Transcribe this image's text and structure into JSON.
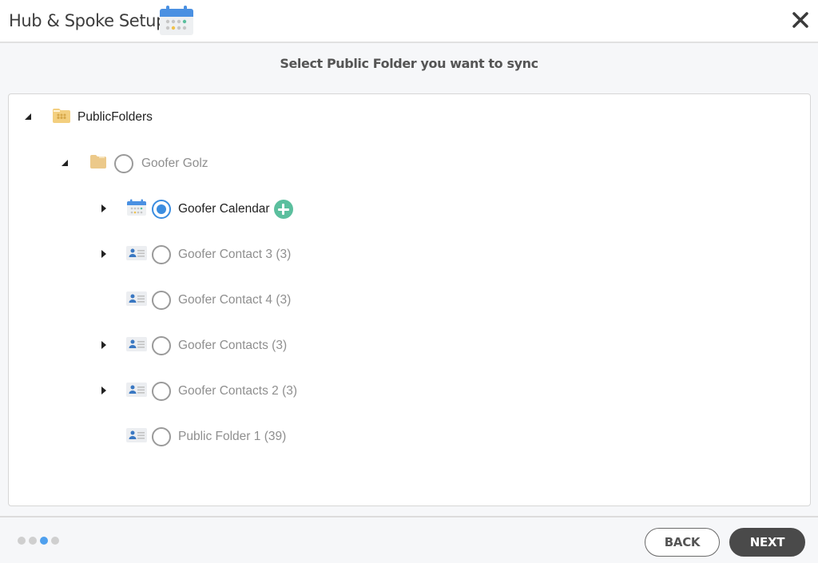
{
  "header": {
    "title": "Hub & Spoke Setup",
    "icon": "calendar-icon",
    "close_icon": "close-icon"
  },
  "subtitle": "Select Public Folder you want to sync",
  "tree": {
    "root": {
      "label": "PublicFolders",
      "icon": "public-folder-icon",
      "expanded": true
    },
    "group": {
      "label": "Goofer Golz",
      "icon": "folder-icon",
      "expanded": true,
      "selected": false
    },
    "items": [
      {
        "label": "Goofer Calendar",
        "icon": "calendar-icon",
        "expandable": true,
        "selected": true,
        "has_add": true
      },
      {
        "label": "Goofer Contact 3 (3)",
        "icon": "contact-card-icon",
        "expandable": true,
        "selected": false
      },
      {
        "label": "Goofer Contact 4 (3)",
        "icon": "contact-card-icon",
        "expandable": false,
        "selected": false
      },
      {
        "label": "Goofer Contacts (3)",
        "icon": "contact-card-icon",
        "expandable": true,
        "selected": false
      },
      {
        "label": "Goofer Contacts 2 (3)",
        "icon": "contact-card-icon",
        "expandable": true,
        "selected": false
      },
      {
        "label": "Public Folder 1 (39)",
        "icon": "contact-card-icon",
        "expandable": false,
        "selected": false
      }
    ]
  },
  "footer": {
    "steps_total": 4,
    "current_step": 3,
    "back_label": "BACK",
    "next_label": "NEXT"
  },
  "colors": {
    "accent_blue": "#3b8de0",
    "add_green": "#5bbf9e",
    "next_button": "#4a4a4a"
  }
}
